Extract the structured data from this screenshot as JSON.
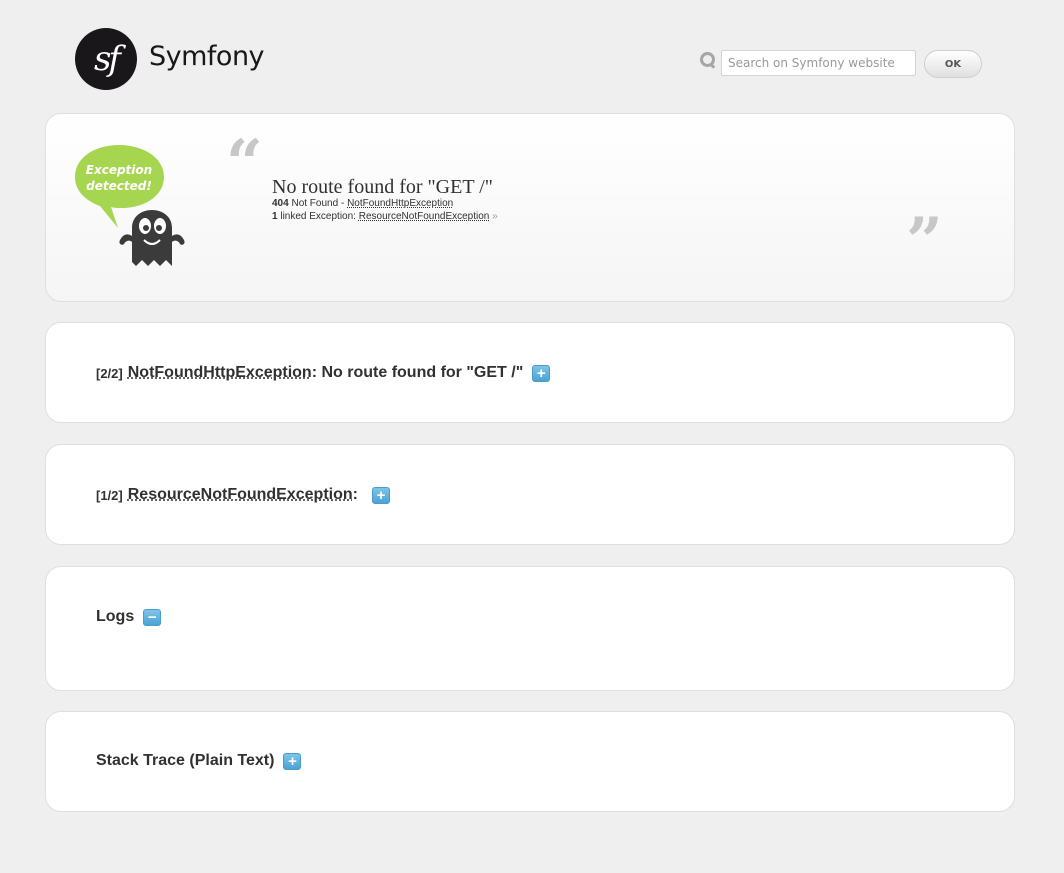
{
  "header": {
    "logo_text": "Symfony",
    "logo_mark": "sf",
    "search_placeholder": "Search on Symfony website",
    "ok_label": "OK"
  },
  "exception": {
    "bubble_text": "Exception detected!",
    "message": "No route found for \"GET /\"",
    "status_code": "404",
    "status_text": "Not Found - ",
    "exception_class": "NotFoundHttpException",
    "linked_count": "1",
    "linked_label": " linked Exception: ",
    "linked_class": "ResourceNotFoundException",
    "linked_arrow": " »",
    "quote_open": "“",
    "quote_close": "”"
  },
  "sections": [
    {
      "counter": "[2/2]",
      "class_name": "NotFoundHttpException",
      "message": ": No route found for \"GET /\"",
      "toggle": "+"
    },
    {
      "counter": "[1/2]",
      "class_name": "ResourceNotFoundException",
      "message": ":",
      "toggle": "+"
    },
    {
      "title": "Logs",
      "toggle": "−"
    },
    {
      "title": "Stack Trace (Plain Text)",
      "toggle": "+"
    }
  ],
  "colors": {
    "background": "#efefef",
    "toggle_blue": "#4aa3d4",
    "bubble_green": "#a6d64f",
    "ghost_dark": "#3b3b3b"
  }
}
